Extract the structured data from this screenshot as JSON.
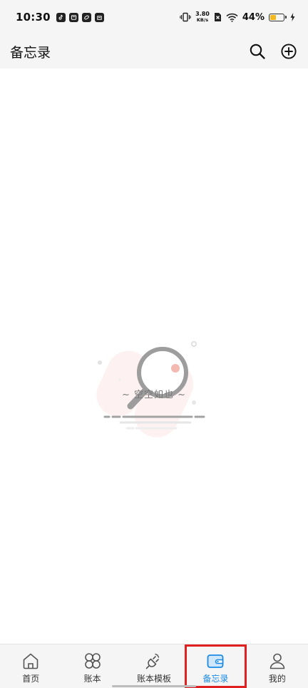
{
  "status_bar": {
    "time": "10:30",
    "net_speed_value": "3.80",
    "net_speed_unit": "KB/s",
    "battery_percent": "44%",
    "battery_level": 0.44,
    "battery_color": "#f5b81c"
  },
  "header": {
    "title": "备忘录",
    "search_icon": "search-icon",
    "add_icon": "add-circle-icon"
  },
  "empty_state": {
    "text": "~ 空空如也 ~",
    "accent": "#f3b9b0"
  },
  "bottom_nav": {
    "active_color": "#1b8ae6",
    "items": [
      {
        "label": "首页",
        "icon": "home-icon"
      },
      {
        "label": "账本",
        "icon": "grid-petal-icon"
      },
      {
        "label": "账本模板",
        "icon": "plug-icon"
      },
      {
        "label": "备忘录",
        "icon": "wallet-icon",
        "active": true
      },
      {
        "label": "我的",
        "icon": "person-icon"
      }
    ]
  }
}
